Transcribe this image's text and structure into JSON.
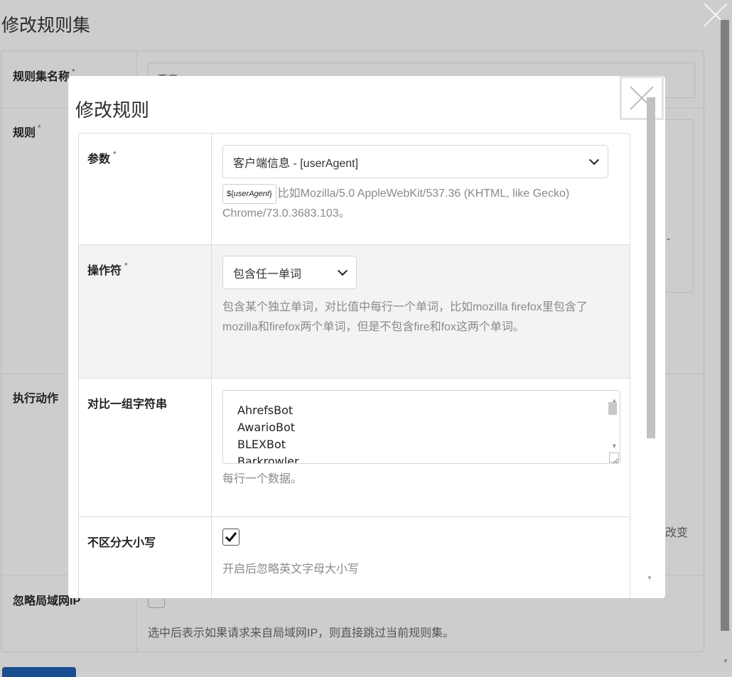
{
  "background_dialog": {
    "title": "修改规则集",
    "fields": {
      "name_label": "规则集名称",
      "rules_label": "规则",
      "action_label": "执行动作",
      "ignore_lan_label": "忽略局域网IP",
      "required_mark": "*"
    },
    "name_value_fragment": "恶意BOT",
    "dash": "-",
    "change_fragment": "改变",
    "ignore_lan_help": "选中后表示如果请求来自局域网IP，则直接跳过当前规则集。"
  },
  "modal": {
    "title": "修改规则",
    "required_mark": "*",
    "param": {
      "label": "参数",
      "selected": "客户端信息 - [userAgent]",
      "variable_prefix": "${",
      "variable_name": "userAgent",
      "variable_suffix": "}",
      "example": "比如Mozilla/5.0 AppleWebKit/537.36 (KHTML, like Gecko) Chrome/73.0.3683.103。"
    },
    "operator": {
      "label": "操作符",
      "selected": "包含任一单词",
      "help": "包含某个独立单词，对比值中每行一个单词，比如mozilla firefox里包含了mozilla和firefox两个单词，但是不包含fire和fox这两个单词。"
    },
    "compare": {
      "label": "对比一组字符串",
      "lines": [
        "AhrefsBot",
        "AwarioBot",
        "BLEXBot",
        "Barkrowler"
      ],
      "help": "每行一个数据。"
    },
    "case_insensitive": {
      "label": "不区分大小写",
      "checked": true,
      "help": "开启后忽略英文字母大小写"
    }
  },
  "colors": {
    "overlay_bg": "#cdcdcd",
    "modal_bg": "#ffffff",
    "shaded_row": "#f3f3f3",
    "help_text": "#8a8a8a",
    "primary_button": "#1a4d8f"
  }
}
